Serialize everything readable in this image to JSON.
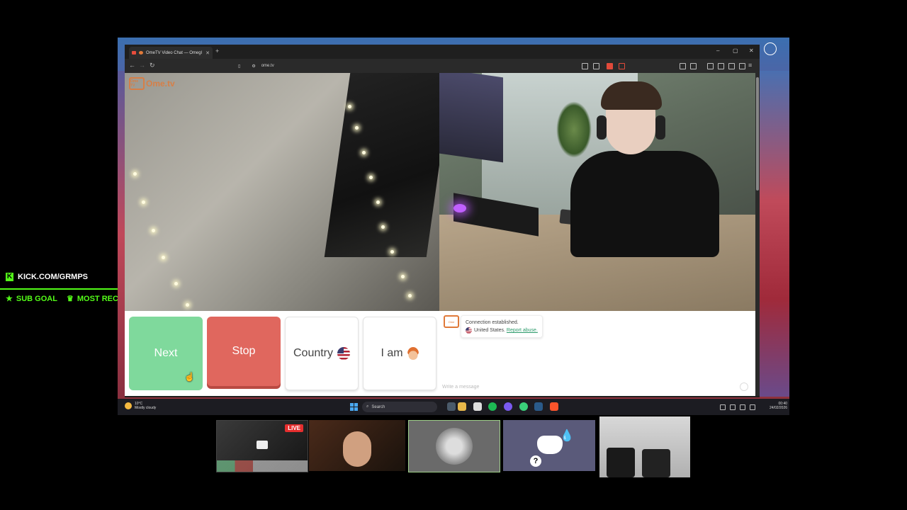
{
  "overlay": {
    "kick_url": "KICK.COM/GRMPS",
    "sub_goal": "SUB GOAL",
    "most_recent": "MOST RECENT",
    "accent": "#53fc18"
  },
  "browser": {
    "tab_title": "OmeTV Video Chat — Omegl",
    "url": "ome.tv",
    "new_tab": "+",
    "minimize": "–",
    "maximize": "▢",
    "close": "✕"
  },
  "site": {
    "logo_text": "Ome.tv",
    "logo_badge": "Ome TV",
    "buttons": {
      "next": "Next",
      "stop": "Stop",
      "country": "Country",
      "i_am": "I am"
    },
    "chat": {
      "status": "Connection established.",
      "country": "United States.",
      "report_link": "Report abuse.",
      "placeholder": "Write a message"
    },
    "colors": {
      "next": "#7fd99c",
      "stop": "#e0675e",
      "brand": "#e07a3a"
    }
  },
  "taskbar": {
    "temperature": "10°C",
    "weather": "Mostly cloudy",
    "search": "Search",
    "time": "00:40",
    "date": "24/02/2026"
  },
  "thumbnails": {
    "live_badge": "LIVE"
  }
}
